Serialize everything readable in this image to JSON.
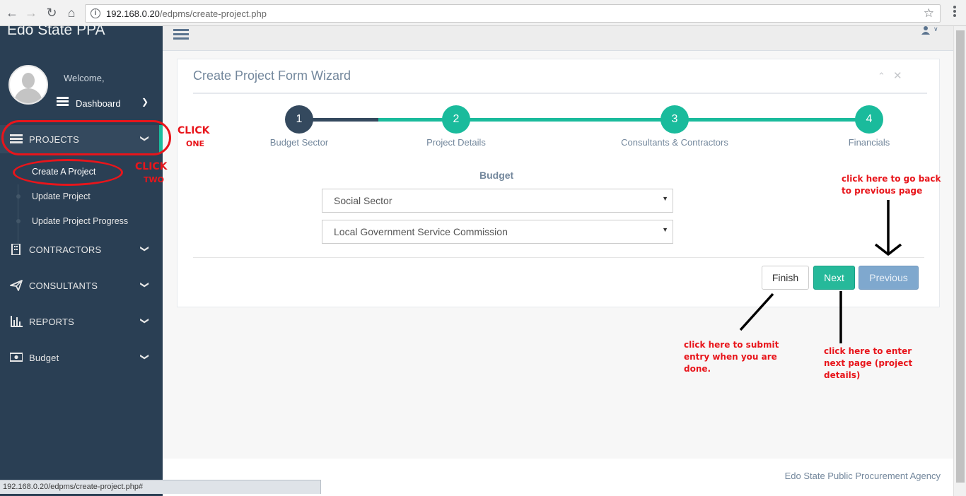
{
  "browser": {
    "url_host": "192.168.0.20",
    "url_path": "/edpms/create-project.php",
    "status_url": "192.168.0.20/edpms/create-project.php#"
  },
  "sidebar": {
    "brand": "Edo State PPA",
    "welcome": "Welcome,",
    "dashboard": "Dashboard",
    "menu": [
      {
        "label": "PROJECTS",
        "icon": "list-icon"
      },
      {
        "label": "CONTRACTORS",
        "icon": "building-icon"
      },
      {
        "label": "CONSULTANTS",
        "icon": "paper-plane-icon"
      },
      {
        "label": "REPORTS",
        "icon": "bar-chart-icon"
      },
      {
        "label": "Budget",
        "icon": "money-icon"
      }
    ],
    "projects_sub": [
      "Create A Project",
      "Update Project",
      "Update Project Progress"
    ]
  },
  "panel": {
    "title": "Create Project Form Wizard",
    "steps": [
      {
        "num": "1",
        "label": "Budget Sector"
      },
      {
        "num": "2",
        "label": "Project Details"
      },
      {
        "num": "3",
        "label": "Consultants & Contractors"
      },
      {
        "num": "4",
        "label": "Financials"
      }
    ],
    "budget_label": "Budget",
    "select_1": "Social Sector",
    "select_2": "Local Government Service Commission",
    "finish_label": "Finish",
    "next_label": "Next",
    "previous_label": "Previous"
  },
  "footer": "Edo State Public Procurement Agency",
  "annotations": {
    "click_one_a": "CLICK",
    "click_one_b": "ONE",
    "click_two_a": "CLICK",
    "click_two_b": "TWO",
    "note_prev": [
      "click here to go back",
      "to previous page"
    ],
    "note_finish": [
      "click here to submit",
      "entry when you are",
      "done."
    ],
    "note_next": [
      "click here to enter",
      "next page (project",
      "details)"
    ],
    "ink_color": "#e8151b"
  },
  "colors": {
    "sidebar": "#2a3f54",
    "accent_green": "#1abb9c",
    "done_step": "#34495e",
    "prev_button": "#7fa8ce"
  }
}
